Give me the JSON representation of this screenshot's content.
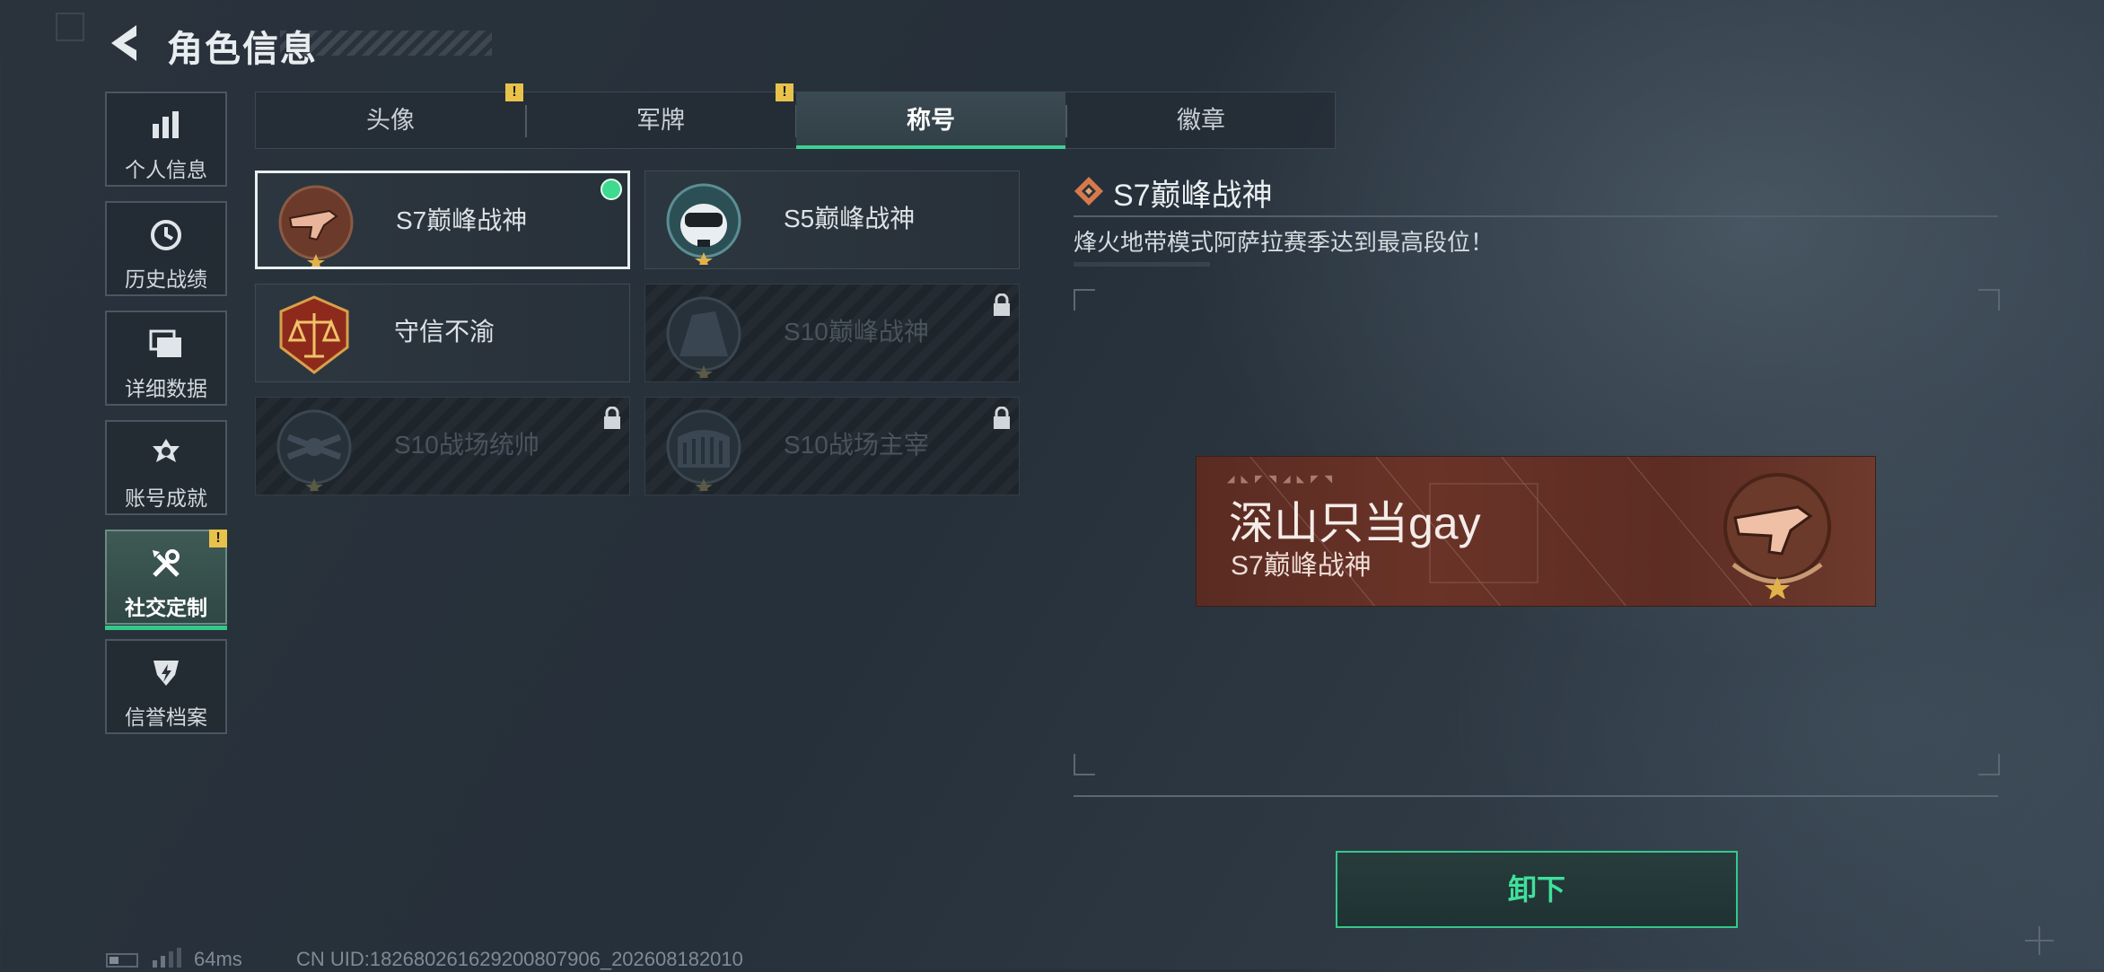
{
  "header": {
    "title": "角色信息"
  },
  "sidebar": {
    "items": [
      {
        "label": "个人信息",
        "icon": "bar-chart-icon"
      },
      {
        "label": "历史战绩",
        "icon": "history-clock-icon"
      },
      {
        "label": "详细数据",
        "icon": "folder-stack-icon"
      },
      {
        "label": "账号成就",
        "icon": "achievement-medal-icon"
      },
      {
        "label": "社交定制",
        "icon": "tools-wrench-icon",
        "active": true,
        "warning": "!"
      },
      {
        "label": "信誉档案",
        "icon": "credit-shield-icon"
      }
    ]
  },
  "tabs": [
    {
      "label": "头像",
      "warning": "!"
    },
    {
      "label": "军牌",
      "warning": "!"
    },
    {
      "label": "称号",
      "active": true
    },
    {
      "label": "徽章"
    }
  ],
  "titles": [
    {
      "name": "S7巅峰战神",
      "emblem": "s7-smg-emblem-icon",
      "selected": true,
      "equipped": true,
      "locked": false
    },
    {
      "name": "S5巅峰战神",
      "emblem": "s5-skull-emblem-icon",
      "locked": false
    },
    {
      "name": "守信不渝",
      "emblem": "justice-scales-emblem-icon",
      "locked": false
    },
    {
      "name": "S10巅峰战神",
      "emblem": "s10-monument-emblem-icon",
      "locked": true
    },
    {
      "name": "S10战场统帅",
      "emblem": "s10-drone-emblem-icon",
      "locked": true
    },
    {
      "name": "S10战场主宰",
      "emblem": "s10-colosseum-emblem-icon",
      "locked": true
    }
  ],
  "detail": {
    "title": "S7巅峰战神",
    "description": "烽火地带模式阿萨拉赛季达到最高段位！",
    "preview": {
      "player_name": "深山只当gay",
      "title": "S7巅峰战神"
    },
    "action_label": "卸下"
  },
  "status": {
    "ping": "64ms",
    "uid": "CN UID:1826802616292008079​06_202608182010"
  },
  "colors": {
    "accent": "#35c78a",
    "warning": "#e8c24a",
    "plate": "#5a2b22"
  }
}
